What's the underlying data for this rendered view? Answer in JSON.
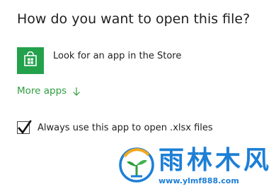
{
  "dialog": {
    "title": "How do you want to open this file?",
    "store_option": {
      "label": "Look for an app in the Store",
      "icon": "store-bag-icon",
      "tile_color": "#24a14b"
    },
    "more_apps": {
      "label": "More apps",
      "icon": "arrow-down-icon",
      "color": "#2e9e3e"
    },
    "always_use": {
      "label": "Always use this app to open .xlsx files",
      "checked": true
    }
  },
  "watermark": {
    "text": "雨林木风",
    "url": "www.ylmf888.com",
    "color": "#1d7fd6"
  }
}
